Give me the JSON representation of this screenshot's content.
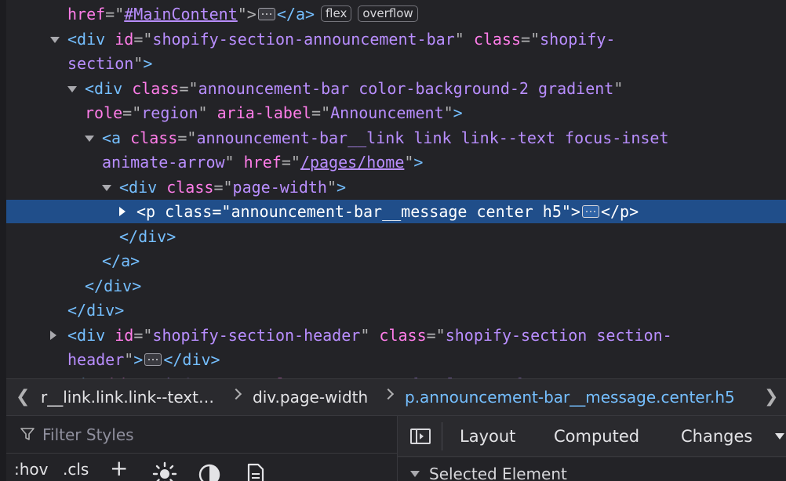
{
  "markup": {
    "lines": [
      {
        "indent": 3,
        "twisty": "",
        "selected": false,
        "parts": [
          {
            "t": "attr",
            "v": "href"
          },
          {
            "t": "pun",
            "v": "=\""
          },
          {
            "t": "val link",
            "v": "#MainContent"
          },
          {
            "t": "pun",
            "v": "\">"
          },
          {
            "t": "dots",
            "v": ""
          },
          {
            "t": "tag",
            "v": "</a>"
          },
          {
            "t": "badge",
            "v": "flex"
          },
          {
            "t": "badge",
            "v": "overflow"
          }
        ]
      },
      {
        "indent": 3,
        "twisty": "open",
        "selected": false,
        "parts": [
          {
            "t": "tag",
            "v": "<div "
          },
          {
            "t": "attr",
            "v": "id"
          },
          {
            "t": "pun",
            "v": "=\""
          },
          {
            "t": "val",
            "v": "shopify-section-announcement-bar"
          },
          {
            "t": "pun",
            "v": "\" "
          },
          {
            "t": "attr",
            "v": "class"
          },
          {
            "t": "pun",
            "v": "=\""
          },
          {
            "t": "val",
            "v": "shopify-"
          }
        ]
      },
      {
        "indent": 3,
        "twisty": "",
        "selected": false,
        "parts": [
          {
            "t": "val",
            "v": "section"
          },
          {
            "t": "pun",
            "v": "\""
          },
          {
            "t": "tag",
            "v": ">"
          }
        ]
      },
      {
        "indent": 4,
        "twisty": "open",
        "selected": false,
        "parts": [
          {
            "t": "tag",
            "v": "<div "
          },
          {
            "t": "attr",
            "v": "class"
          },
          {
            "t": "pun",
            "v": "=\""
          },
          {
            "t": "val",
            "v": "announcement-bar color-background-2 gradient"
          },
          {
            "t": "pun",
            "v": "\""
          }
        ]
      },
      {
        "indent": 4,
        "twisty": "",
        "selected": false,
        "parts": [
          {
            "t": "attr",
            "v": "role"
          },
          {
            "t": "pun",
            "v": "=\""
          },
          {
            "t": "val",
            "v": "region"
          },
          {
            "t": "pun",
            "v": "\" "
          },
          {
            "t": "attr",
            "v": "aria-label"
          },
          {
            "t": "pun",
            "v": "=\""
          },
          {
            "t": "val",
            "v": "Announcement"
          },
          {
            "t": "pun",
            "v": "\""
          },
          {
            "t": "tag",
            "v": ">"
          }
        ]
      },
      {
        "indent": 5,
        "twisty": "open",
        "selected": false,
        "parts": [
          {
            "t": "tag",
            "v": "<a "
          },
          {
            "t": "attr",
            "v": "class"
          },
          {
            "t": "pun",
            "v": "=\""
          },
          {
            "t": "val",
            "v": "announcement-bar__link link link--text focus-inset"
          }
        ]
      },
      {
        "indent": 5,
        "twisty": "",
        "selected": false,
        "parts": [
          {
            "t": "val",
            "v": "animate-arrow"
          },
          {
            "t": "pun",
            "v": "\" "
          },
          {
            "t": "attr",
            "v": "href"
          },
          {
            "t": "pun",
            "v": "=\""
          },
          {
            "t": "val link",
            "v": "/pages/home"
          },
          {
            "t": "pun",
            "v": "\""
          },
          {
            "t": "tag",
            "v": ">"
          }
        ]
      },
      {
        "indent": 6,
        "twisty": "open",
        "selected": false,
        "parts": [
          {
            "t": "tag",
            "v": "<div "
          },
          {
            "t": "attr",
            "v": "class"
          },
          {
            "t": "pun",
            "v": "=\""
          },
          {
            "t": "val",
            "v": "page-width"
          },
          {
            "t": "pun",
            "v": "\""
          },
          {
            "t": "tag",
            "v": ">"
          }
        ]
      },
      {
        "indent": 7,
        "twisty": "closed",
        "selected": true,
        "parts": [
          {
            "t": "tag",
            "v": "<p "
          },
          {
            "t": "attr",
            "v": "class"
          },
          {
            "t": "pun",
            "v": "=\""
          },
          {
            "t": "val",
            "v": "announcement-bar__message center h5"
          },
          {
            "t": "pun",
            "v": "\""
          },
          {
            "t": "tag",
            "v": ">"
          },
          {
            "t": "dots",
            "v": ""
          },
          {
            "t": "tag",
            "v": "</p>"
          }
        ]
      },
      {
        "indent": 6,
        "twisty": "",
        "selected": false,
        "parts": [
          {
            "t": "tag",
            "v": "</div>"
          }
        ]
      },
      {
        "indent": 5,
        "twisty": "",
        "selected": false,
        "parts": [
          {
            "t": "tag",
            "v": "</a>"
          }
        ]
      },
      {
        "indent": 4,
        "twisty": "",
        "selected": false,
        "parts": [
          {
            "t": "tag",
            "v": "</div>"
          }
        ]
      },
      {
        "indent": 3,
        "twisty": "",
        "selected": false,
        "parts": [
          {
            "t": "tag",
            "v": "</div>"
          }
        ]
      },
      {
        "indent": 3,
        "twisty": "closed-grey",
        "selected": false,
        "parts": [
          {
            "t": "tag",
            "v": "<div "
          },
          {
            "t": "attr",
            "v": "id"
          },
          {
            "t": "pun",
            "v": "=\""
          },
          {
            "t": "val",
            "v": "shopify-section-header"
          },
          {
            "t": "pun",
            "v": "\" "
          },
          {
            "t": "attr",
            "v": "class"
          },
          {
            "t": "pun",
            "v": "=\""
          },
          {
            "t": "val",
            "v": "shopify-section section-"
          }
        ]
      },
      {
        "indent": 3,
        "twisty": "",
        "selected": false,
        "parts": [
          {
            "t": "val",
            "v": "header"
          },
          {
            "t": "pun",
            "v": "\""
          },
          {
            "t": "tag",
            "v": ">"
          },
          {
            "t": "dots",
            "v": ""
          },
          {
            "t": "tag",
            "v": "</div>"
          }
        ]
      },
      {
        "indent": 2,
        "twisty": "open",
        "selected": false,
        "parts": [
          {
            "t": "tag",
            "v": "<main "
          },
          {
            "t": "attr",
            "v": "id"
          },
          {
            "t": "pun",
            "v": "=\""
          },
          {
            "t": "val",
            "v": "MainContent"
          },
          {
            "t": "pun",
            "v": "\" "
          },
          {
            "t": "attr",
            "v": "class"
          },
          {
            "t": "pun",
            "v": "=\""
          },
          {
            "t": "val",
            "v": "content-for-layout focus-none"
          },
          {
            "t": "pun",
            "v": "\""
          }
        ]
      }
    ]
  },
  "breadcrumb": {
    "items": [
      "r__link.link.link--text…",
      "div.page-width",
      "p.announcement-bar__message.center.h5"
    ],
    "current_index": 2
  },
  "rules": {
    "filter_placeholder": "Filter Styles",
    "hov_label": ":hov",
    "cls_label": ".cls",
    "add_rule": "+"
  },
  "sidebar": {
    "tabs": [
      "Layout",
      "Computed",
      "Changes"
    ],
    "section_label": "Selected Element"
  },
  "colors": {
    "tag": "#75bfff",
    "attribute": "#ff7de9",
    "value": "#b98eff",
    "selection": "#204e8a",
    "background": "#232327"
  }
}
